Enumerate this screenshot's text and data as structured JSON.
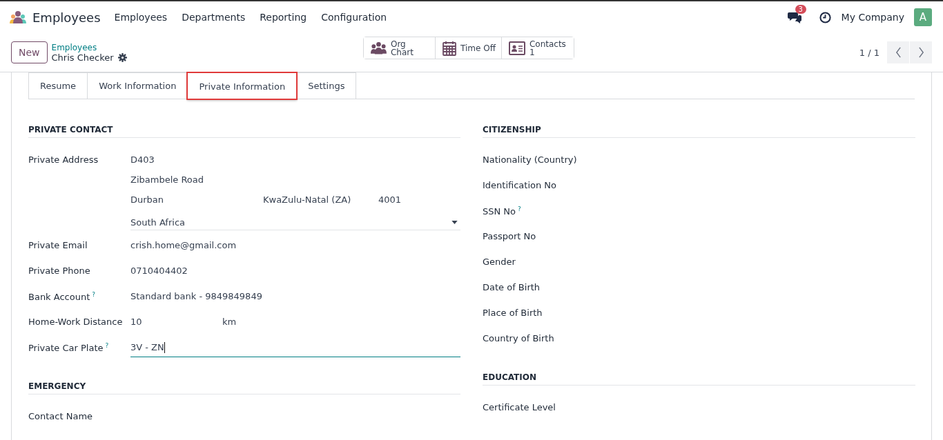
{
  "navbar": {
    "app_title": "Employees",
    "menu": [
      "Employees",
      "Departments",
      "Reporting",
      "Configuration"
    ],
    "messages_count": "3",
    "company": "My Company",
    "avatar": "A"
  },
  "control_panel": {
    "new_button": "New",
    "breadcrumb_parent": "Employees",
    "record_name": "Chris Checker",
    "pager": "1 / 1"
  },
  "smart_buttons": [
    {
      "kind": "org",
      "label": "Org Chart"
    },
    {
      "kind": "calendar",
      "label": "Time Off"
    },
    {
      "kind": "contact",
      "label": "Contacts",
      "value": "1"
    }
  ],
  "tabs": [
    {
      "label": "Resume",
      "selected": false
    },
    {
      "label": "Work Information",
      "selected": false
    },
    {
      "label": "Private Information",
      "selected": true
    },
    {
      "label": "Settings",
      "selected": false
    }
  ],
  "columns": [
    [
      {
        "title": "PRIVATE CONTACT",
        "fields": [
          {
            "kind": "address",
            "label": "Private Address",
            "street": "D403",
            "street2": "Zibambele Road",
            "city": "Durban",
            "state": "KwaZulu-Natal (ZA)",
            "zip": "4001",
            "country": "South Africa"
          },
          {
            "kind": "text",
            "label": "Private Email",
            "value": "crish.home@gmail.com"
          },
          {
            "kind": "text",
            "label": "Private Phone",
            "value": "0710404402"
          },
          {
            "kind": "text",
            "label": "Bank Account",
            "help": "?",
            "value": "Standard bank - 9849849849"
          },
          {
            "kind": "distance",
            "label": "Home-Work Distance",
            "value": "10",
            "unit": "km"
          },
          {
            "kind": "input",
            "label": "Private Car Plate",
            "help": "?",
            "value": "3V - ZN"
          }
        ]
      },
      {
        "title": "EMERGENCY",
        "fields": [
          {
            "kind": "text",
            "label": "Contact Name"
          }
        ]
      }
    ],
    [
      {
        "title": "CITIZENSHIP",
        "fields": [
          {
            "kind": "text",
            "label": "Nationality (Country)"
          },
          {
            "kind": "text",
            "label": "Identification No"
          },
          {
            "kind": "text",
            "label": "SSN No",
            "help": "?"
          },
          {
            "kind": "text",
            "label": "Passport No"
          },
          {
            "kind": "text",
            "label": "Gender"
          },
          {
            "kind": "text",
            "label": "Date of Birth"
          },
          {
            "kind": "text",
            "label": "Place of Birth"
          },
          {
            "kind": "text",
            "label": "Country of Birth"
          }
        ]
      },
      {
        "title": "EDUCATION",
        "fields": [
          {
            "kind": "text",
            "label": "Certificate Level"
          }
        ]
      }
    ]
  ]
}
